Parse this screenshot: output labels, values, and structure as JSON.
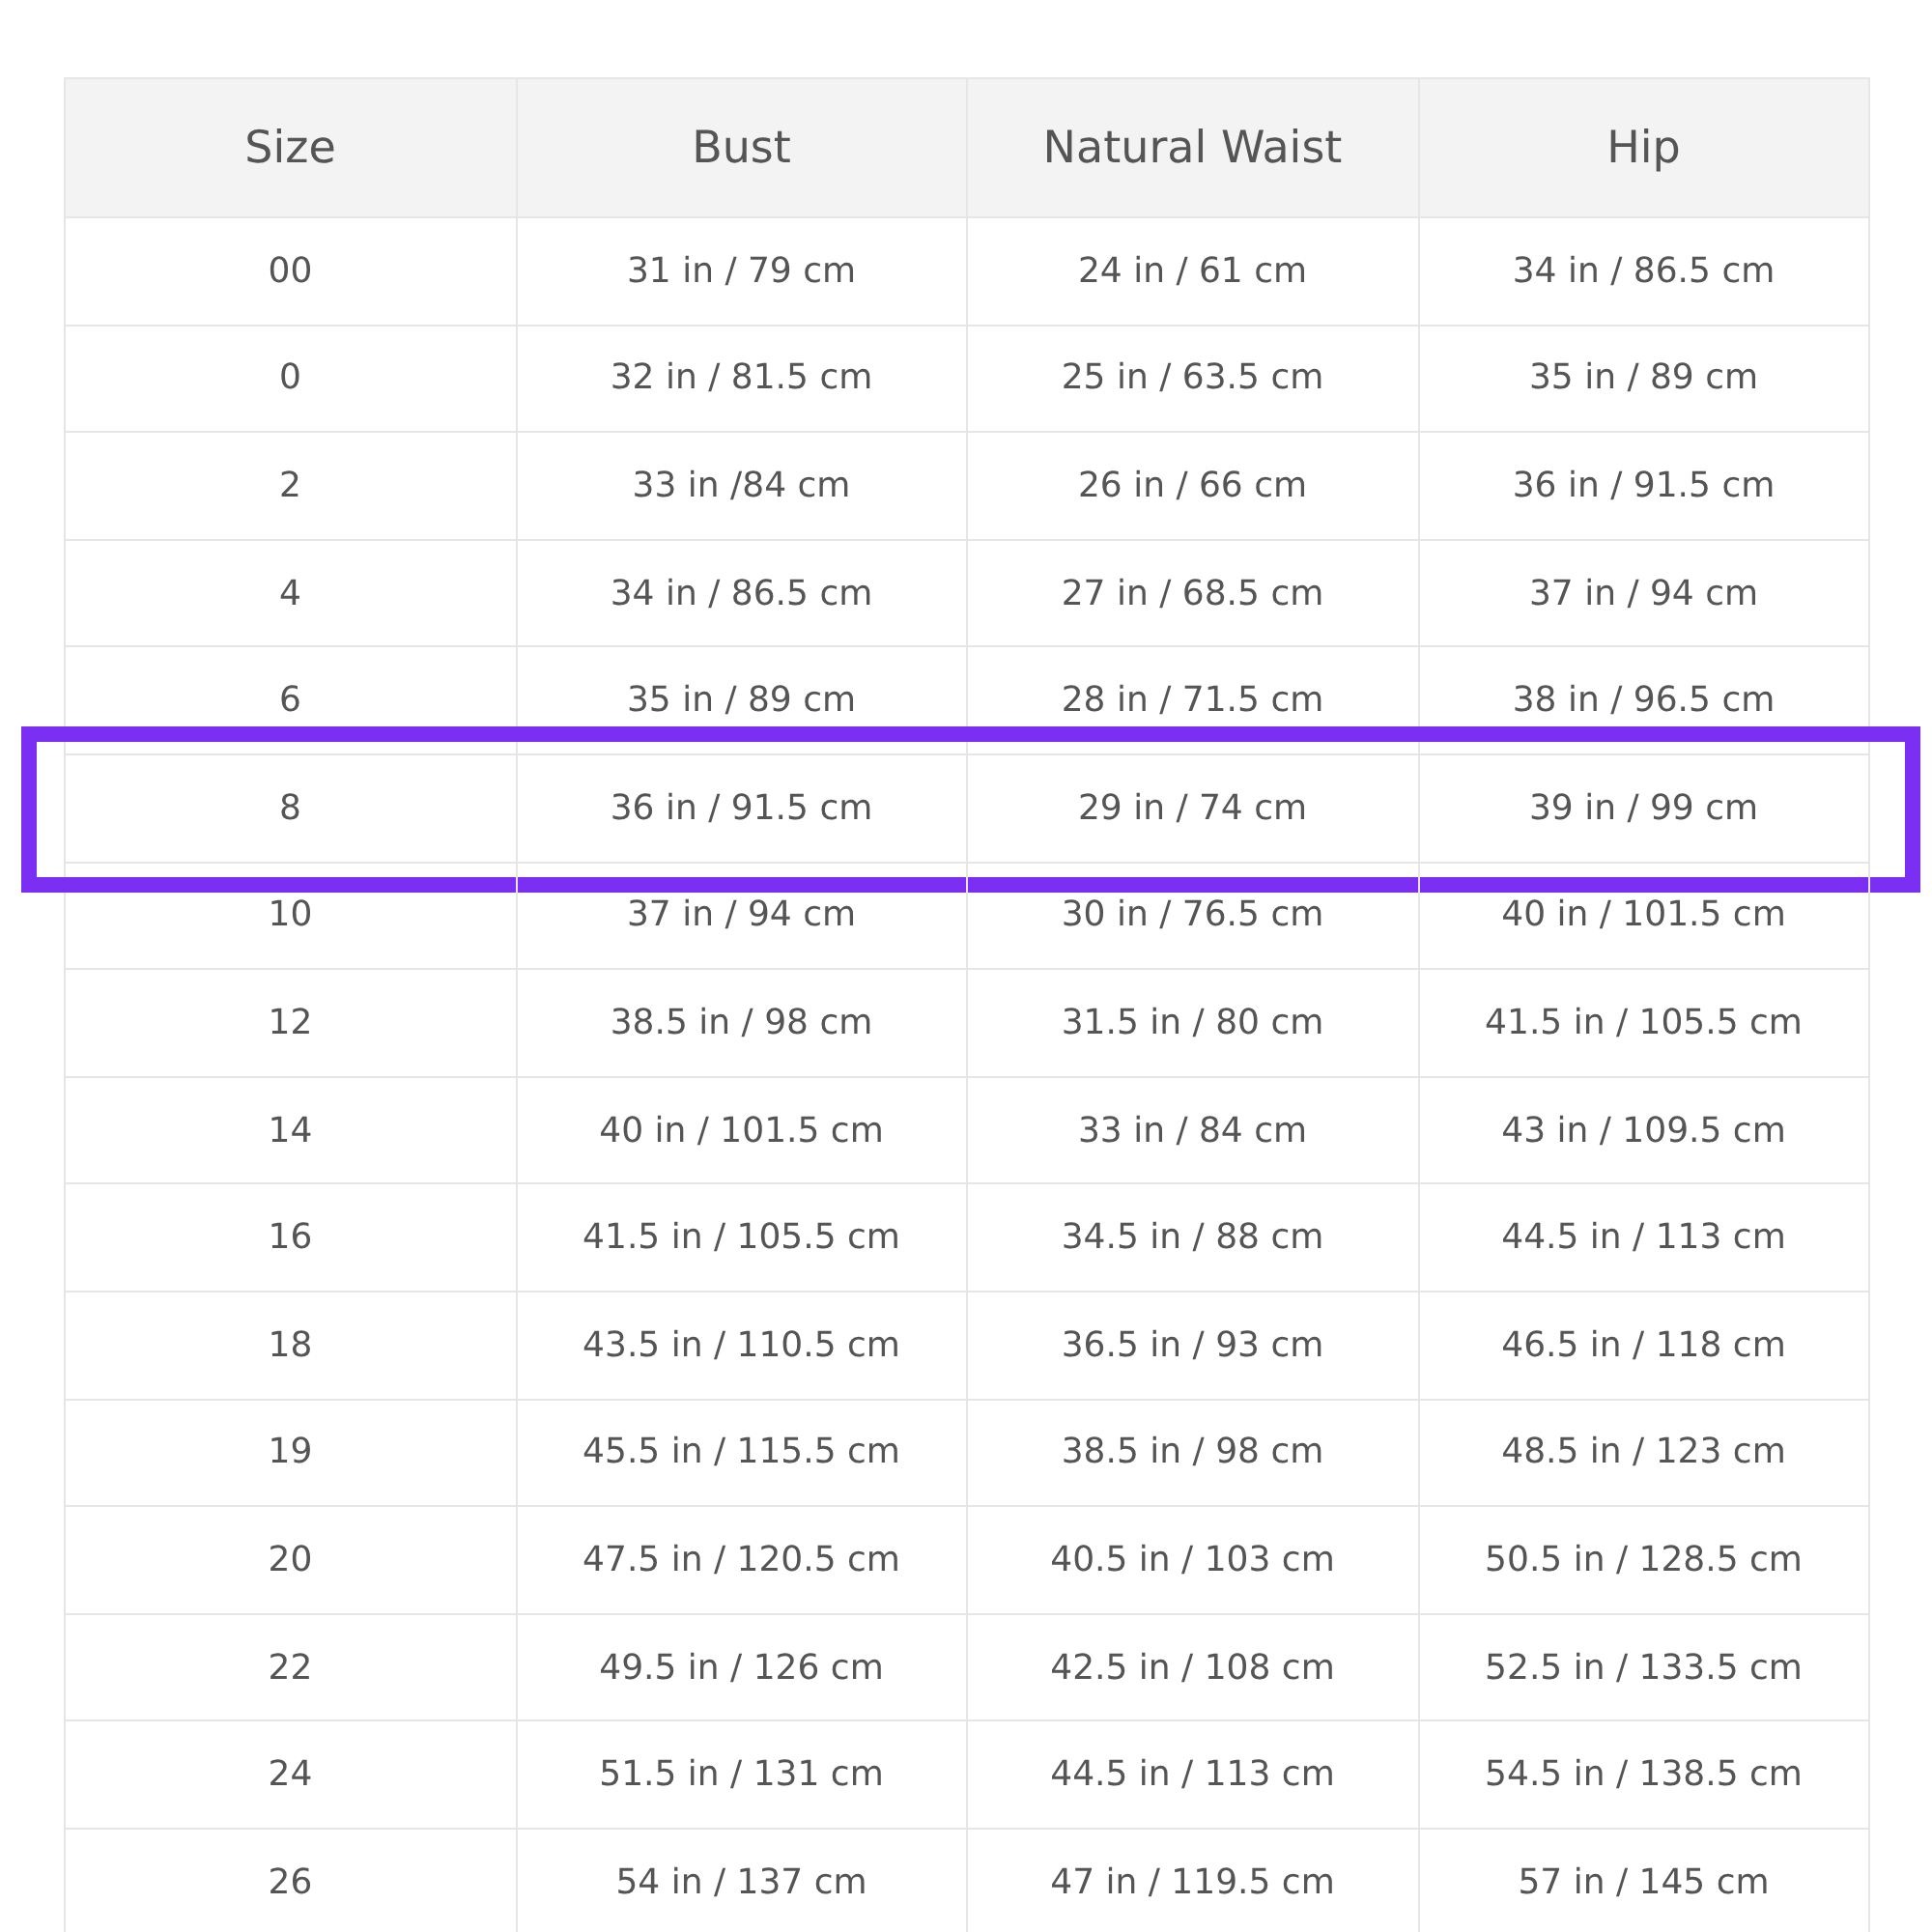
{
  "table": {
    "columns": [
      "Size",
      "Bust",
      "Natural Waist",
      "Hip"
    ],
    "rows": [
      {
        "cells": [
          "00",
          "31 in / 79 cm",
          "24 in / 61 cm",
          "34 in / 86.5 cm"
        ],
        "selected": false
      },
      {
        "cells": [
          "0",
          "32 in / 81.5 cm",
          "25 in / 63.5 cm",
          "35 in / 89 cm"
        ],
        "selected": false
      },
      {
        "cells": [
          "2",
          "33 in /84 cm",
          "26 in / 66 cm",
          "36 in / 91.5 cm"
        ],
        "selected": false
      },
      {
        "cells": [
          "4",
          "34 in / 86.5 cm",
          "27 in / 68.5 cm",
          "37 in / 94 cm"
        ],
        "selected": false
      },
      {
        "cells": [
          "6",
          "35 in / 89 cm",
          "28 in / 71.5 cm",
          "38 in / 96.5 cm"
        ],
        "selected": false
      },
      {
        "cells": [
          "8",
          "36 in / 91.5 cm",
          "29 in / 74 cm",
          "39 in / 99 cm"
        ],
        "selected": true
      },
      {
        "cells": [
          "10",
          "37 in / 94 cm",
          "30 in / 76.5 cm",
          "40 in / 101.5 cm"
        ],
        "selected": false
      },
      {
        "cells": [
          "12",
          "38.5 in / 98 cm",
          "31.5 in / 80 cm",
          "41.5 in / 105.5 cm"
        ],
        "selected": false
      },
      {
        "cells": [
          "14",
          "40 in / 101.5 cm",
          "33 in / 84 cm",
          "43 in / 109.5 cm"
        ],
        "selected": false
      },
      {
        "cells": [
          "16",
          "41.5 in / 105.5 cm",
          "34.5 in / 88 cm",
          "44.5 in / 113 cm"
        ],
        "selected": false
      },
      {
        "cells": [
          "18",
          "43.5 in / 110.5 cm",
          "36.5 in / 93 cm",
          "46.5 in / 118 cm"
        ],
        "selected": false
      },
      {
        "cells": [
          "19",
          "45.5 in / 115.5 cm",
          "38.5 in / 98 cm",
          "48.5 in / 123 cm"
        ],
        "selected": false
      },
      {
        "cells": [
          "20",
          "47.5 in / 120.5 cm",
          "40.5 in / 103 cm",
          "50.5 in / 128.5 cm"
        ],
        "selected": false
      },
      {
        "cells": [
          "22",
          "49.5 in / 126 cm",
          "42.5 in / 108 cm",
          "52.5 in / 133.5 cm"
        ],
        "selected": false
      },
      {
        "cells": [
          "24",
          "51.5 in / 131 cm",
          "44.5 in / 113 cm",
          "54.5 in / 138.5 cm"
        ],
        "selected": false
      },
      {
        "cells": [
          "26",
          "54 in / 137 cm",
          "47 in / 119.5 cm",
          "57 in / 145 cm"
        ],
        "selected": false
      }
    ]
  }
}
